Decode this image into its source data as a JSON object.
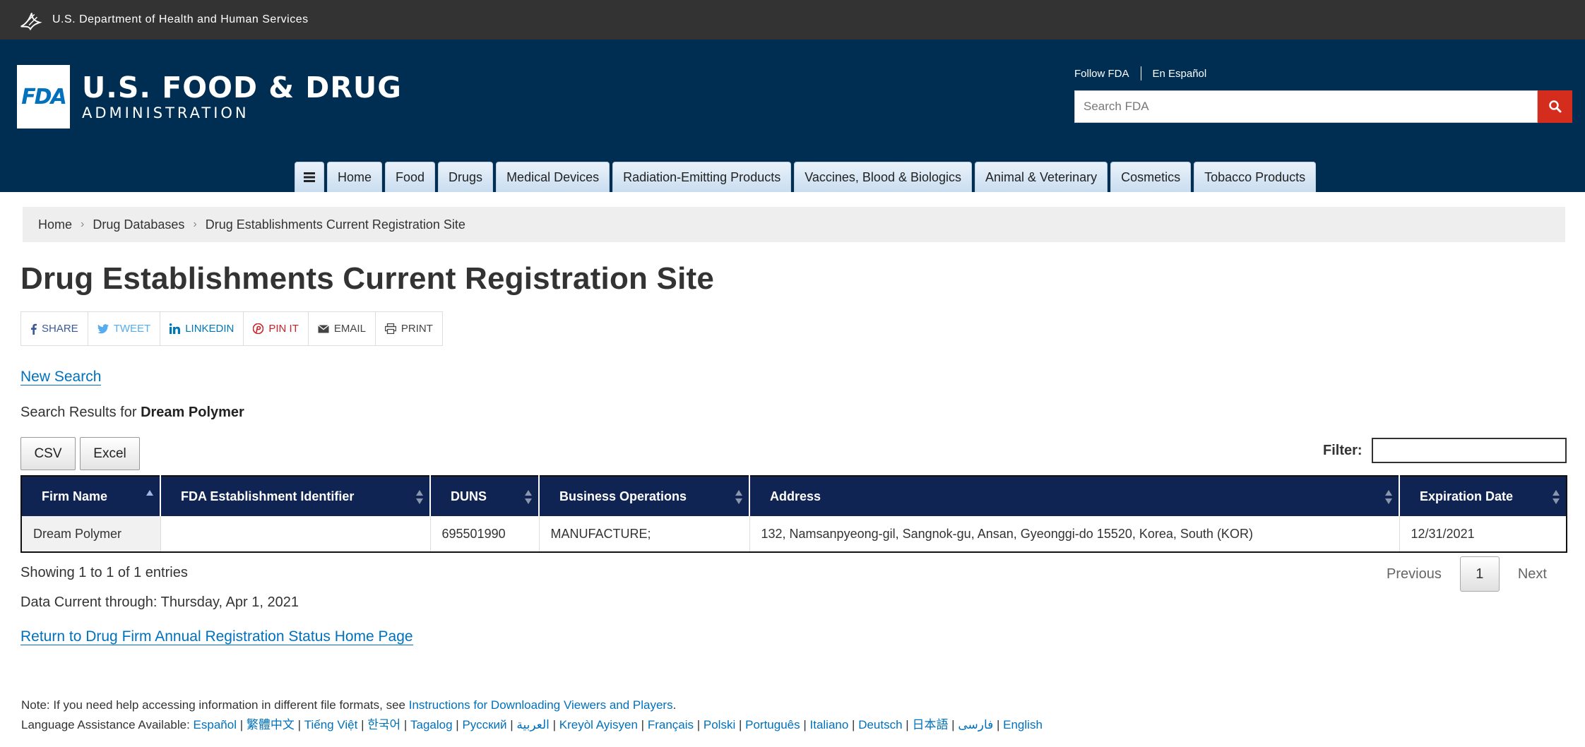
{
  "hhs": {
    "title": "U.S. Department of Health and Human Services"
  },
  "header": {
    "logo_mark": "FDA",
    "logo_title": "U.S. FOOD & DRUG",
    "logo_sub": "ADMINISTRATION",
    "follow": "Follow FDA",
    "espanol": "En Español",
    "search_placeholder": "Search FDA"
  },
  "nav": [
    "Home",
    "Food",
    "Drugs",
    "Medical Devices",
    "Radiation-Emitting Products",
    "Vaccines, Blood & Biologics",
    "Animal & Veterinary",
    "Cosmetics",
    "Tobacco Products"
  ],
  "breadcrumb": [
    "Home",
    "Drug Databases",
    "Drug Establishments Current Registration Site"
  ],
  "page_title": "Drug Establishments Current Registration Site",
  "share": [
    {
      "label": "SHARE",
      "color": "#3b5998",
      "icon": "facebook-icon"
    },
    {
      "label": "TWEET",
      "color": "#55acee",
      "icon": "twitter-icon"
    },
    {
      "label": "LINKEDIN",
      "color": "#0077b5",
      "icon": "linkedin-icon"
    },
    {
      "label": "PIN IT",
      "color": "#cb2027",
      "icon": "pinterest-icon"
    },
    {
      "label": "EMAIL",
      "color": "#444444",
      "icon": "email-icon"
    },
    {
      "label": "PRINT",
      "color": "#444444",
      "icon": "print-icon"
    }
  ],
  "new_search": "New Search",
  "results": {
    "prefix": "Search Results for ",
    "term": "Dream Polymer"
  },
  "buttons": {
    "csv": "CSV",
    "excel": "Excel"
  },
  "filter": {
    "label": "Filter:"
  },
  "table": {
    "headers": [
      "Firm Name",
      "FDA Establishment Identifier",
      "DUNS",
      "Business Operations",
      "Address",
      "Expiration Date"
    ],
    "rows": [
      [
        "Dream Polymer",
        "",
        "695501990",
        "MANUFACTURE;",
        "132, Namsanpyeong-gil, Sangnok-gu, Ansan, Gyeonggi-do 15520, Korea, South (KOR)",
        "12/31/2021"
      ]
    ]
  },
  "showing": "Showing 1 to 1 of 1 entries",
  "pager": {
    "previous": "Previous",
    "page": "1",
    "next": "Next"
  },
  "data_current": "Data Current through: Thursday, Apr 1, 2021",
  "return_link": "Return to Drug Firm Annual Registration Status Home Page",
  "note": {
    "text": "Note: If you need help accessing information in different file formats, see ",
    "link": "Instructions for Downloading Viewers and Players",
    "end": "."
  },
  "language": {
    "prefix": "Language Assistance Available: ",
    "items": [
      "Español",
      "繁體中文",
      "Tiếng Việt",
      "한국어",
      "Tagalog",
      "Русский",
      "العربية",
      "Kreyòl Ayisyen",
      "Français",
      "Polski",
      "Português",
      "Italiano",
      "Deutsch",
      "日本語",
      "فارسی",
      "English"
    ]
  }
}
